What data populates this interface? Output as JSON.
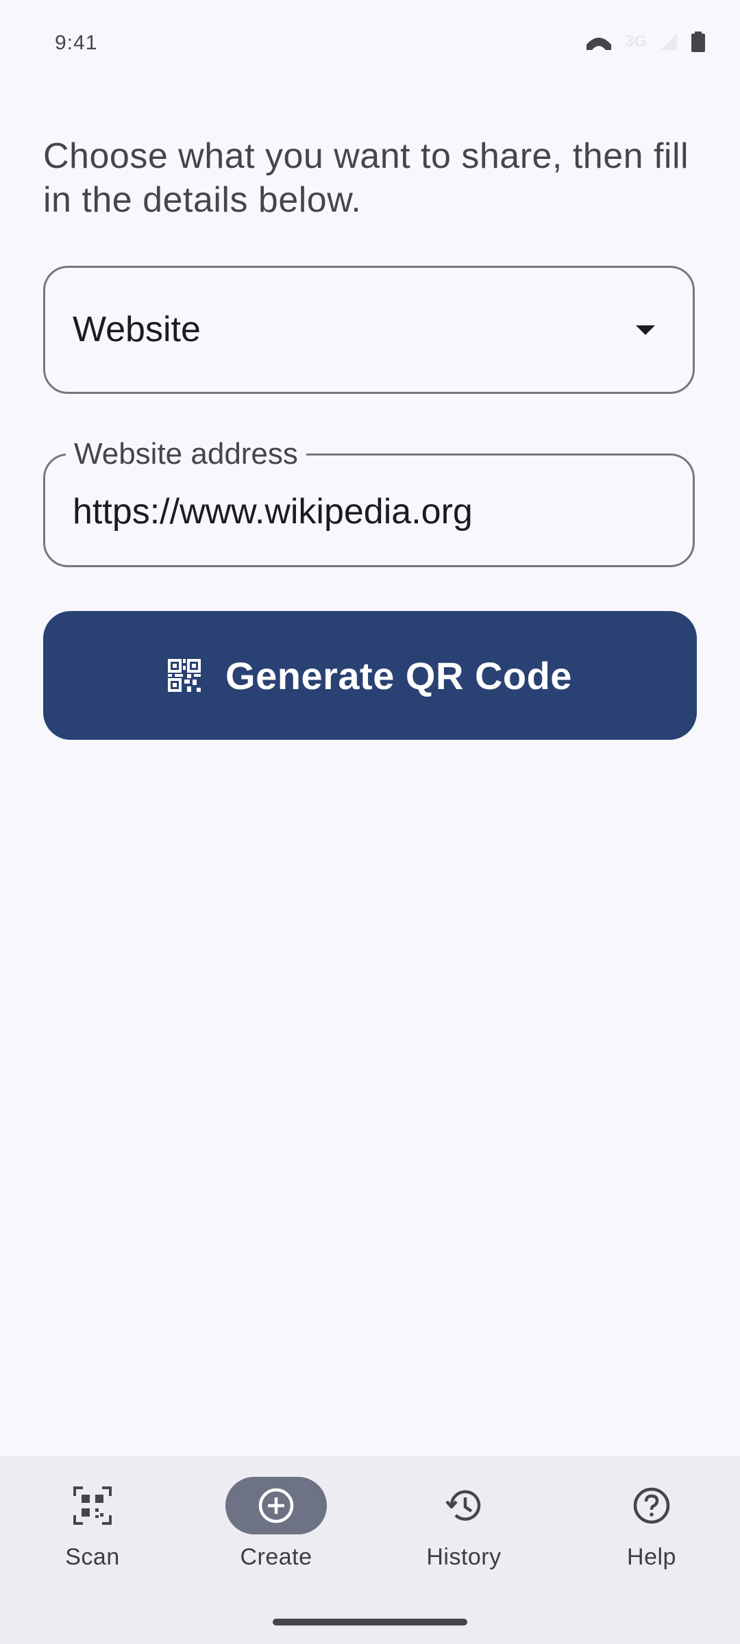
{
  "status_bar": {
    "time": "9:41",
    "network": "3G",
    "icons": [
      "privacy-eye-icon",
      "signal-icon",
      "battery-icon"
    ]
  },
  "intro_text": "Choose what you want to share, then fill in the details below.",
  "content_type_dropdown": {
    "selected": "Website"
  },
  "url_field": {
    "label": "Website address",
    "value": "https://www.wikipedia.org"
  },
  "generate_button": {
    "label": "Generate QR Code",
    "icon": "qr-code-icon",
    "color": "#2a4173"
  },
  "nav": {
    "items": [
      {
        "label": "Scan",
        "icon": "qr-scan-icon",
        "active": false
      },
      {
        "label": "Create",
        "icon": "add-circle-icon",
        "active": true
      },
      {
        "label": "History",
        "icon": "history-icon",
        "active": false
      },
      {
        "label": "Help",
        "icon": "help-icon",
        "active": false
      }
    ],
    "active_indicator_color": "#6d7285"
  }
}
